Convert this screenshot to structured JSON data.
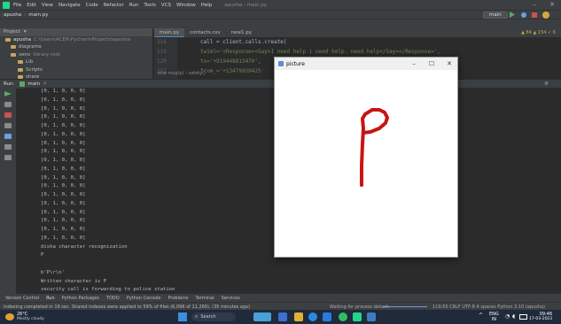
{
  "titlebar": {
    "menus": [
      "File",
      "Edit",
      "View",
      "Navigate",
      "Code",
      "Refactor",
      "Run",
      "Tools",
      "VCS",
      "Window",
      "Help"
    ],
    "project_title": "apusha - main.py",
    "minimize": "–",
    "close": "✕"
  },
  "navbar": {
    "crumbs": [
      "apusha",
      "main.py"
    ],
    "run_config": "main"
  },
  "project_panel": {
    "header": "Project",
    "items": [
      {
        "label": "apusha",
        "detail": "C:\\Users\\ACER\\PycharmProjects\\apusha"
      },
      {
        "label": "diagrams"
      },
      {
        "label": "venv",
        "detail": "library root"
      },
      {
        "label": "Lib"
      },
      {
        "label": "Scripts"
      },
      {
        "label": "share"
      }
    ]
  },
  "editor": {
    "tabs": [
      "main.py",
      "contacts.csv",
      "new1.py"
    ],
    "line_numbers": [
      "116",
      "119",
      "120",
      "121"
    ],
    "lines": [
      "call = client.calls.create(",
      "    twiml='<Response><Say>I need help i need help. need help</Say></Response>',",
      "    to='+919448813470',",
      "    from_='+13479959425'"
    ],
    "breadcrumbs": "else msg(p) › safety()",
    "inspection": "▲ 84  ▲ 154  ✓ 6"
  },
  "run": {
    "label": "Run:",
    "config": "main",
    "lines": [
      "[0, 1, 0, 0, 0]",
      "[0, 1, 0, 0, 0]",
      "[0, 1, 0, 0, 0]",
      "[0, 1, 0, 0, 0]",
      "[0, 1, 0, 0, 0]",
      "[0, 1, 0, 0, 0]",
      "[0, 1, 0, 0, 0]",
      "[0, 1, 0, 0, 0]",
      "[0, 1, 0, 0, 0]",
      "[0, 1, 0, 0, 0]",
      "[0, 1, 0, 0, 0]",
      "[0, 1, 0, 0, 0]",
      "[0, 1, 0, 0, 0]",
      "[0, 1, 0, 0, 0]",
      "[0, 1, 0, 0, 0]",
      "[0, 1, 0, 0, 0]",
      "[0, 1, 0, 0, 0]",
      "[0, 1, 0, 0, 0]",
      "disha character recognization",
      "P",
      "",
      "b'P\\r\\n'",
      "Written character is P",
      "security call is forwarding to police station"
    ]
  },
  "picture_window": {
    "title": "picture",
    "minimize": "–",
    "maximize": "☐",
    "close": "✕",
    "stroke_color": "#c81414"
  },
  "bottom_tabs": [
    "Version Control",
    "Run",
    "Python Packages",
    "TODO",
    "Python Console",
    "Problems",
    "Terminal",
    "Services"
  ],
  "status": {
    "left": "Indexing completed in 19 sec. Shared indexes were applied to 59% of files (6,096 of 11,269). (35 minutes ago)",
    "middle": "Waiting for process detach",
    "right": "119:55  CRLF  UTF-8  4 spaces  Python 3.10 (apusha)"
  },
  "taskbar": {
    "weather_temp": "26°C",
    "weather_desc": "Mostly cloudy",
    "search_label": "Search",
    "lang": "ENG",
    "lang_region": "IN",
    "time": "09:46",
    "date": "17-03-2023"
  }
}
